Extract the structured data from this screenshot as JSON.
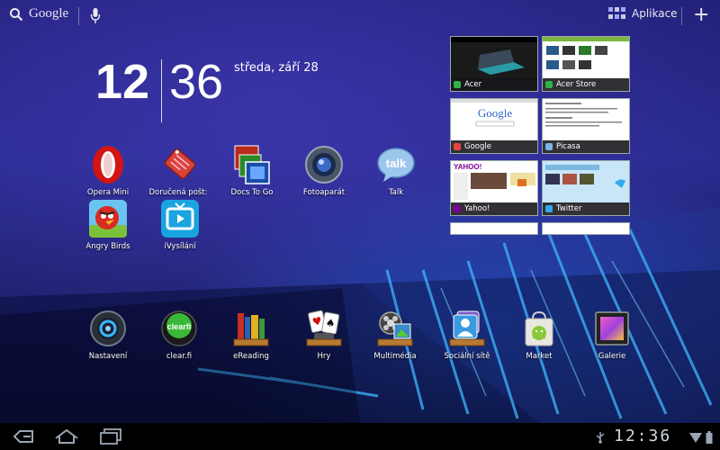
{
  "search": {
    "label": "Google"
  },
  "apps_button": {
    "label": "Aplikace"
  },
  "clock": {
    "hour": "12",
    "minute": "36",
    "date": "středa, září 28"
  },
  "shortcuts": [
    {
      "label": "Opera Mini",
      "icon": "opera-icon"
    },
    {
      "label": "Doručená pošt:",
      "icon": "email-tag-icon"
    },
    {
      "label": "Docs To Go",
      "icon": "docs-to-go-icon"
    },
    {
      "label": "Fotoaparát",
      "icon": "camera-icon"
    },
    {
      "label": "Talk",
      "icon": "talk-icon"
    },
    {
      "label": "Angry Birds",
      "icon": "angry-birds-icon"
    },
    {
      "label": "iVysílání",
      "icon": "tv-icon"
    }
  ],
  "recent_tasks": [
    {
      "label": "Acer",
      "color": "#2db34a"
    },
    {
      "label": "Acer Store",
      "color": "#2db34a"
    },
    {
      "label": "Google",
      "color": "#e8453c"
    },
    {
      "label": "Picasa",
      "color": "#7bb6e8"
    },
    {
      "label": "Yahoo!",
      "color": "#7b0099"
    },
    {
      "label": "Twitter",
      "color": "#33aaee"
    }
  ],
  "dock": [
    {
      "label": "Nastavení",
      "icon": "settings-icon"
    },
    {
      "label": "clear.fi",
      "icon": "clearfi-icon"
    },
    {
      "label": "eReading",
      "icon": "ereading-icon"
    },
    {
      "label": "Hry",
      "icon": "games-icon"
    },
    {
      "label": "Multimédia",
      "icon": "multimedia-icon"
    },
    {
      "label": "Sociální sítě",
      "icon": "social-icon"
    },
    {
      "label": "Market",
      "icon": "market-icon"
    },
    {
      "label": "Galerie",
      "icon": "gallery-icon"
    }
  ],
  "system_bar": {
    "time": "12:36"
  }
}
